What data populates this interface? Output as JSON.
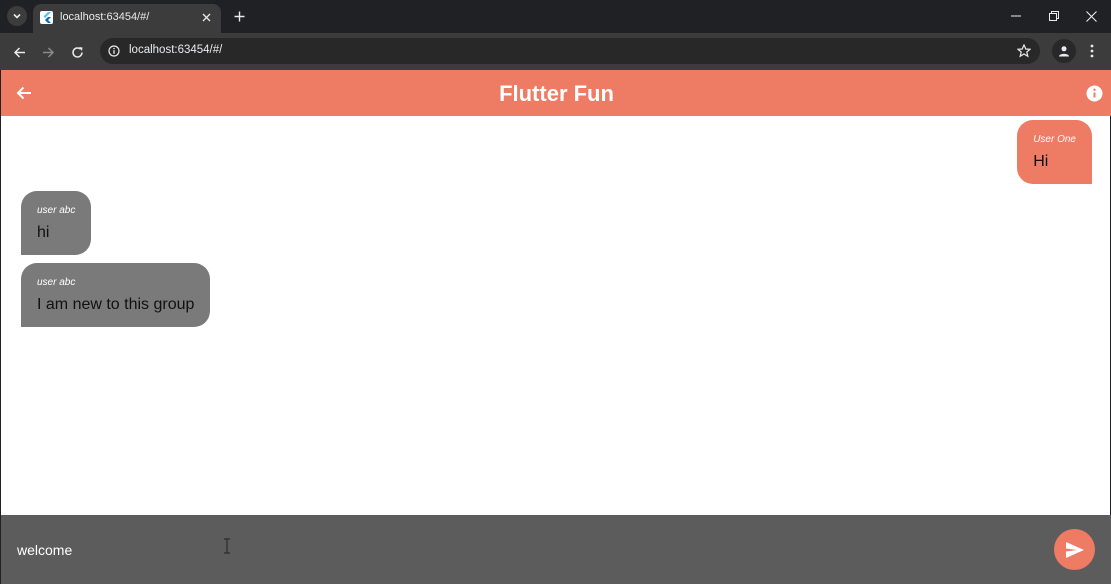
{
  "browser": {
    "tab_title": "localhost:63454/#/",
    "url": "localhost:63454/#/"
  },
  "app": {
    "title": "Flutter Fun",
    "accent_color": "#ee7b63",
    "received_bubble_color": "#7a7a7a",
    "composer_bg": "#5c5c5c"
  },
  "messages": [
    {
      "sender": "User One",
      "text": "Hi",
      "direction": "sent"
    },
    {
      "sender": "user abc",
      "text": "hi",
      "direction": "received"
    },
    {
      "sender": "user abc",
      "text": "I am new to this group",
      "direction": "received"
    }
  ],
  "composer": {
    "value": "welcome"
  },
  "icons": {
    "tab_list": "chevron-down-icon",
    "favicon": "flutter-logo-icon",
    "tab_close": "close-icon",
    "new_tab": "plus-icon",
    "minimize": "minimize-icon",
    "restore": "restore-icon",
    "close_window": "close-icon",
    "back": "arrow-left-icon",
    "forward": "arrow-right-icon",
    "reload": "reload-icon",
    "site_info": "info-icon",
    "bookmark": "star-icon",
    "profile": "person-icon",
    "menu": "more-vert-icon",
    "app_back": "arrow-left-icon",
    "app_info": "info-icon",
    "send": "send-icon"
  }
}
